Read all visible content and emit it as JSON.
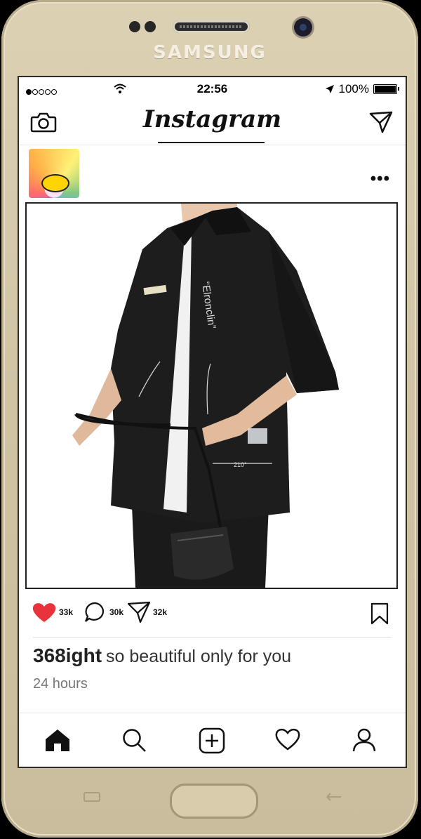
{
  "device": {
    "brand": "SAMSUNG"
  },
  "status_bar": {
    "carrier_signal": "●○○○○",
    "time": "22:56",
    "battery": "100%"
  },
  "app": {
    "title": "Instagram"
  },
  "post": {
    "more_label": "•••",
    "likes": "33k",
    "comments": "30k",
    "shares": "32k",
    "username": "368ight",
    "caption": "so beautiful only for you",
    "time_ago": "24 hours",
    "shirt_text": "“Elronclin”",
    "measure_text": "210°"
  },
  "bottom_nav": [
    "home-icon",
    "search-icon",
    "add-icon",
    "heart-icon",
    "profile-icon"
  ],
  "colors": {
    "like": "#e8333c",
    "frame": "#d6caab",
    "text": "#111111"
  }
}
